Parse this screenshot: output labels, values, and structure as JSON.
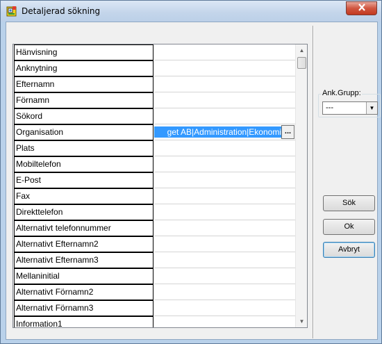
{
  "window": {
    "title": "Detaljerad sökning",
    "icons": {
      "app": "app-icon",
      "close": "close-icon"
    }
  },
  "grid": {
    "rows": [
      {
        "label": "Hänvisning",
        "value": ""
      },
      {
        "label": "Anknytning",
        "value": ""
      },
      {
        "label": "Efternamn",
        "value": ""
      },
      {
        "label": "Förnamn",
        "value": ""
      },
      {
        "label": "Sökord",
        "value": ""
      },
      {
        "label": "Organisation",
        "value": "get AB|Administration|Ekonomi",
        "selected": true
      },
      {
        "label": "Plats",
        "value": ""
      },
      {
        "label": "Mobiltelefon",
        "value": ""
      },
      {
        "label": "E-Post",
        "value": ""
      },
      {
        "label": "Fax",
        "value": ""
      },
      {
        "label": "Direkttelefon",
        "value": ""
      },
      {
        "label": "Alternativt telefonnummer",
        "value": ""
      },
      {
        "label": "Alternativt Efternamn2",
        "value": ""
      },
      {
        "label": "Alternativt Efternamn3",
        "value": ""
      },
      {
        "label": "Mellaninitial",
        "value": ""
      },
      {
        "label": "Alternativt Förnamn2",
        "value": ""
      },
      {
        "label": "Alternativt Förnamn3",
        "value": ""
      },
      {
        "label": "Information1",
        "value": ""
      }
    ],
    "ellipsis_label": "...",
    "scroll": {
      "up_icon": "scroll-up-icon",
      "down_icon": "scroll-down-icon"
    }
  },
  "side": {
    "group_label": "Ank.Grupp:",
    "combo_value": "---",
    "buttons": {
      "search": "Sök",
      "ok": "Ok",
      "cancel": "Avbryt"
    }
  }
}
